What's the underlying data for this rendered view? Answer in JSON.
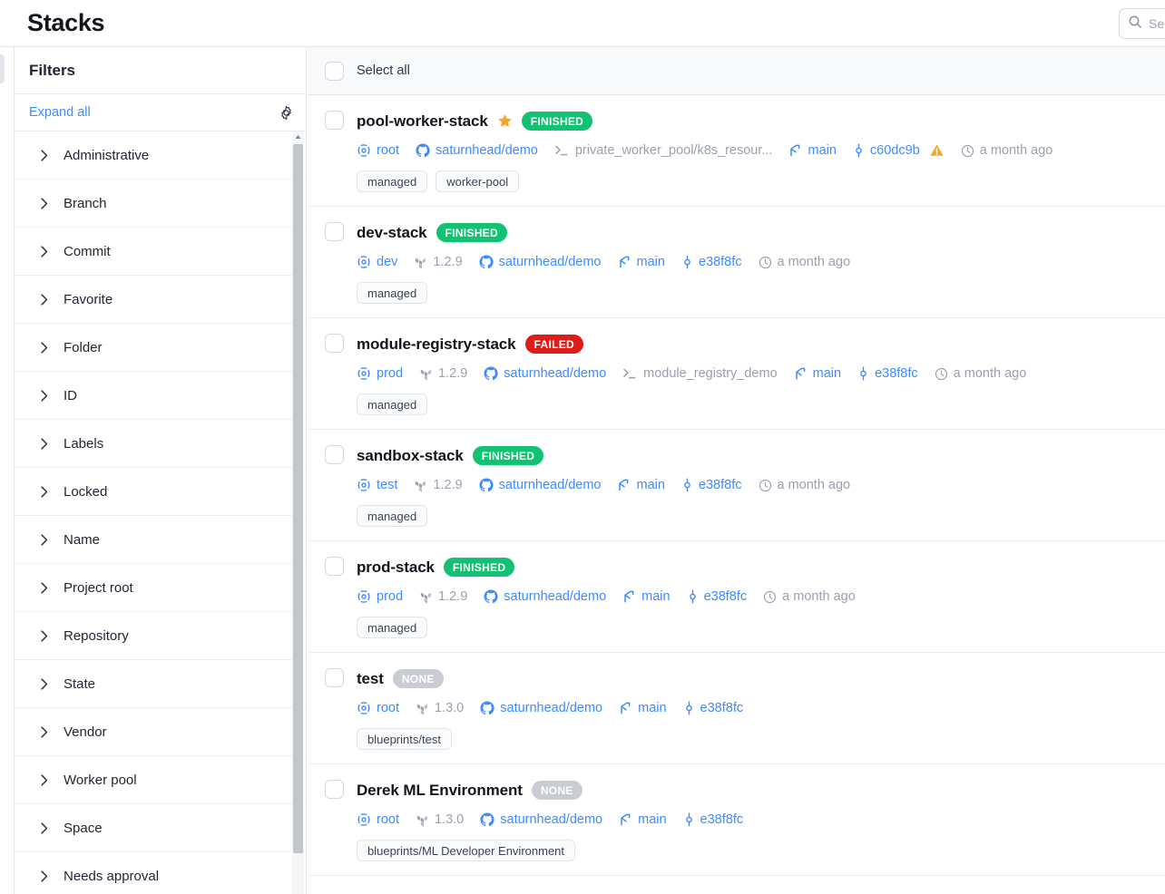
{
  "header": {
    "title": "Stacks",
    "search_placeholder": "Sea",
    "search_icon": "search-icon"
  },
  "sidebar": {
    "title": "Filters",
    "expand_all": "Expand all",
    "settings_icon": "gear-icon",
    "items": [
      {
        "label": "Administrative"
      },
      {
        "label": "Branch"
      },
      {
        "label": "Commit"
      },
      {
        "label": "Favorite"
      },
      {
        "label": "Folder"
      },
      {
        "label": "ID"
      },
      {
        "label": "Labels"
      },
      {
        "label": "Locked"
      },
      {
        "label": "Name"
      },
      {
        "label": "Project root"
      },
      {
        "label": "Repository"
      },
      {
        "label": "State"
      },
      {
        "label": "Vendor"
      },
      {
        "label": "Worker pool"
      },
      {
        "label": "Space"
      },
      {
        "label": "Needs approval"
      }
    ]
  },
  "list": {
    "select_all_label": "Select all",
    "colors": {
      "finished": "#12c273",
      "failed": "#e01c18",
      "none": "#c9ccd4",
      "link": "#3e8bff",
      "muted": "#9aa0ae",
      "star": "#f5a623",
      "warning": "#f5a623"
    },
    "stacks": [
      {
        "name": "pool-worker-stack",
        "favorite": true,
        "status": "FINISHED",
        "status_kind": "finished",
        "space": "root",
        "version": null,
        "repo": "saturnhead/demo",
        "project_root": "private_worker_pool/k8s_resour...",
        "branch": "main",
        "commit": "c60dc9b",
        "warning": true,
        "updated": "a month ago",
        "tags": [
          "managed",
          "worker-pool"
        ]
      },
      {
        "name": "dev-stack",
        "favorite": false,
        "status": "FINISHED",
        "status_kind": "finished",
        "space": "dev",
        "version": "1.2.9",
        "repo": "saturnhead/demo",
        "project_root": null,
        "branch": "main",
        "commit": "e38f8fc",
        "warning": false,
        "updated": "a month ago",
        "tags": [
          "managed"
        ]
      },
      {
        "name": "module-registry-stack",
        "favorite": false,
        "status": "FAILED",
        "status_kind": "failed",
        "space": "prod",
        "version": "1.2.9",
        "repo": "saturnhead/demo",
        "project_root": "module_registry_demo",
        "branch": "main",
        "commit": "e38f8fc",
        "warning": false,
        "updated": "a month ago",
        "tags": [
          "managed"
        ]
      },
      {
        "name": "sandbox-stack",
        "favorite": false,
        "status": "FINISHED",
        "status_kind": "finished",
        "space": "test",
        "version": "1.2.9",
        "repo": "saturnhead/demo",
        "project_root": null,
        "branch": "main",
        "commit": "e38f8fc",
        "warning": false,
        "updated": "a month ago",
        "tags": [
          "managed"
        ]
      },
      {
        "name": "prod-stack",
        "favorite": false,
        "status": "FINISHED",
        "status_kind": "finished",
        "space": "prod",
        "version": "1.2.9",
        "repo": "saturnhead/demo",
        "project_root": null,
        "branch": "main",
        "commit": "e38f8fc",
        "warning": false,
        "updated": "a month ago",
        "tags": [
          "managed"
        ]
      },
      {
        "name": "test",
        "favorite": false,
        "status": "NONE",
        "status_kind": "none",
        "space": "root",
        "version": "1.3.0",
        "repo": "saturnhead/demo",
        "project_root": null,
        "branch": "main",
        "commit": "e38f8fc",
        "warning": false,
        "updated": null,
        "tags": [
          "blueprints/test"
        ]
      },
      {
        "name": "Derek ML Environment",
        "favorite": false,
        "status": "NONE",
        "status_kind": "none",
        "space": "root",
        "version": "1.3.0",
        "repo": "saturnhead/demo",
        "project_root": null,
        "branch": "main",
        "commit": "e38f8fc",
        "warning": false,
        "updated": null,
        "tags": [
          "blueprints/ML Developer Environment"
        ]
      }
    ]
  }
}
